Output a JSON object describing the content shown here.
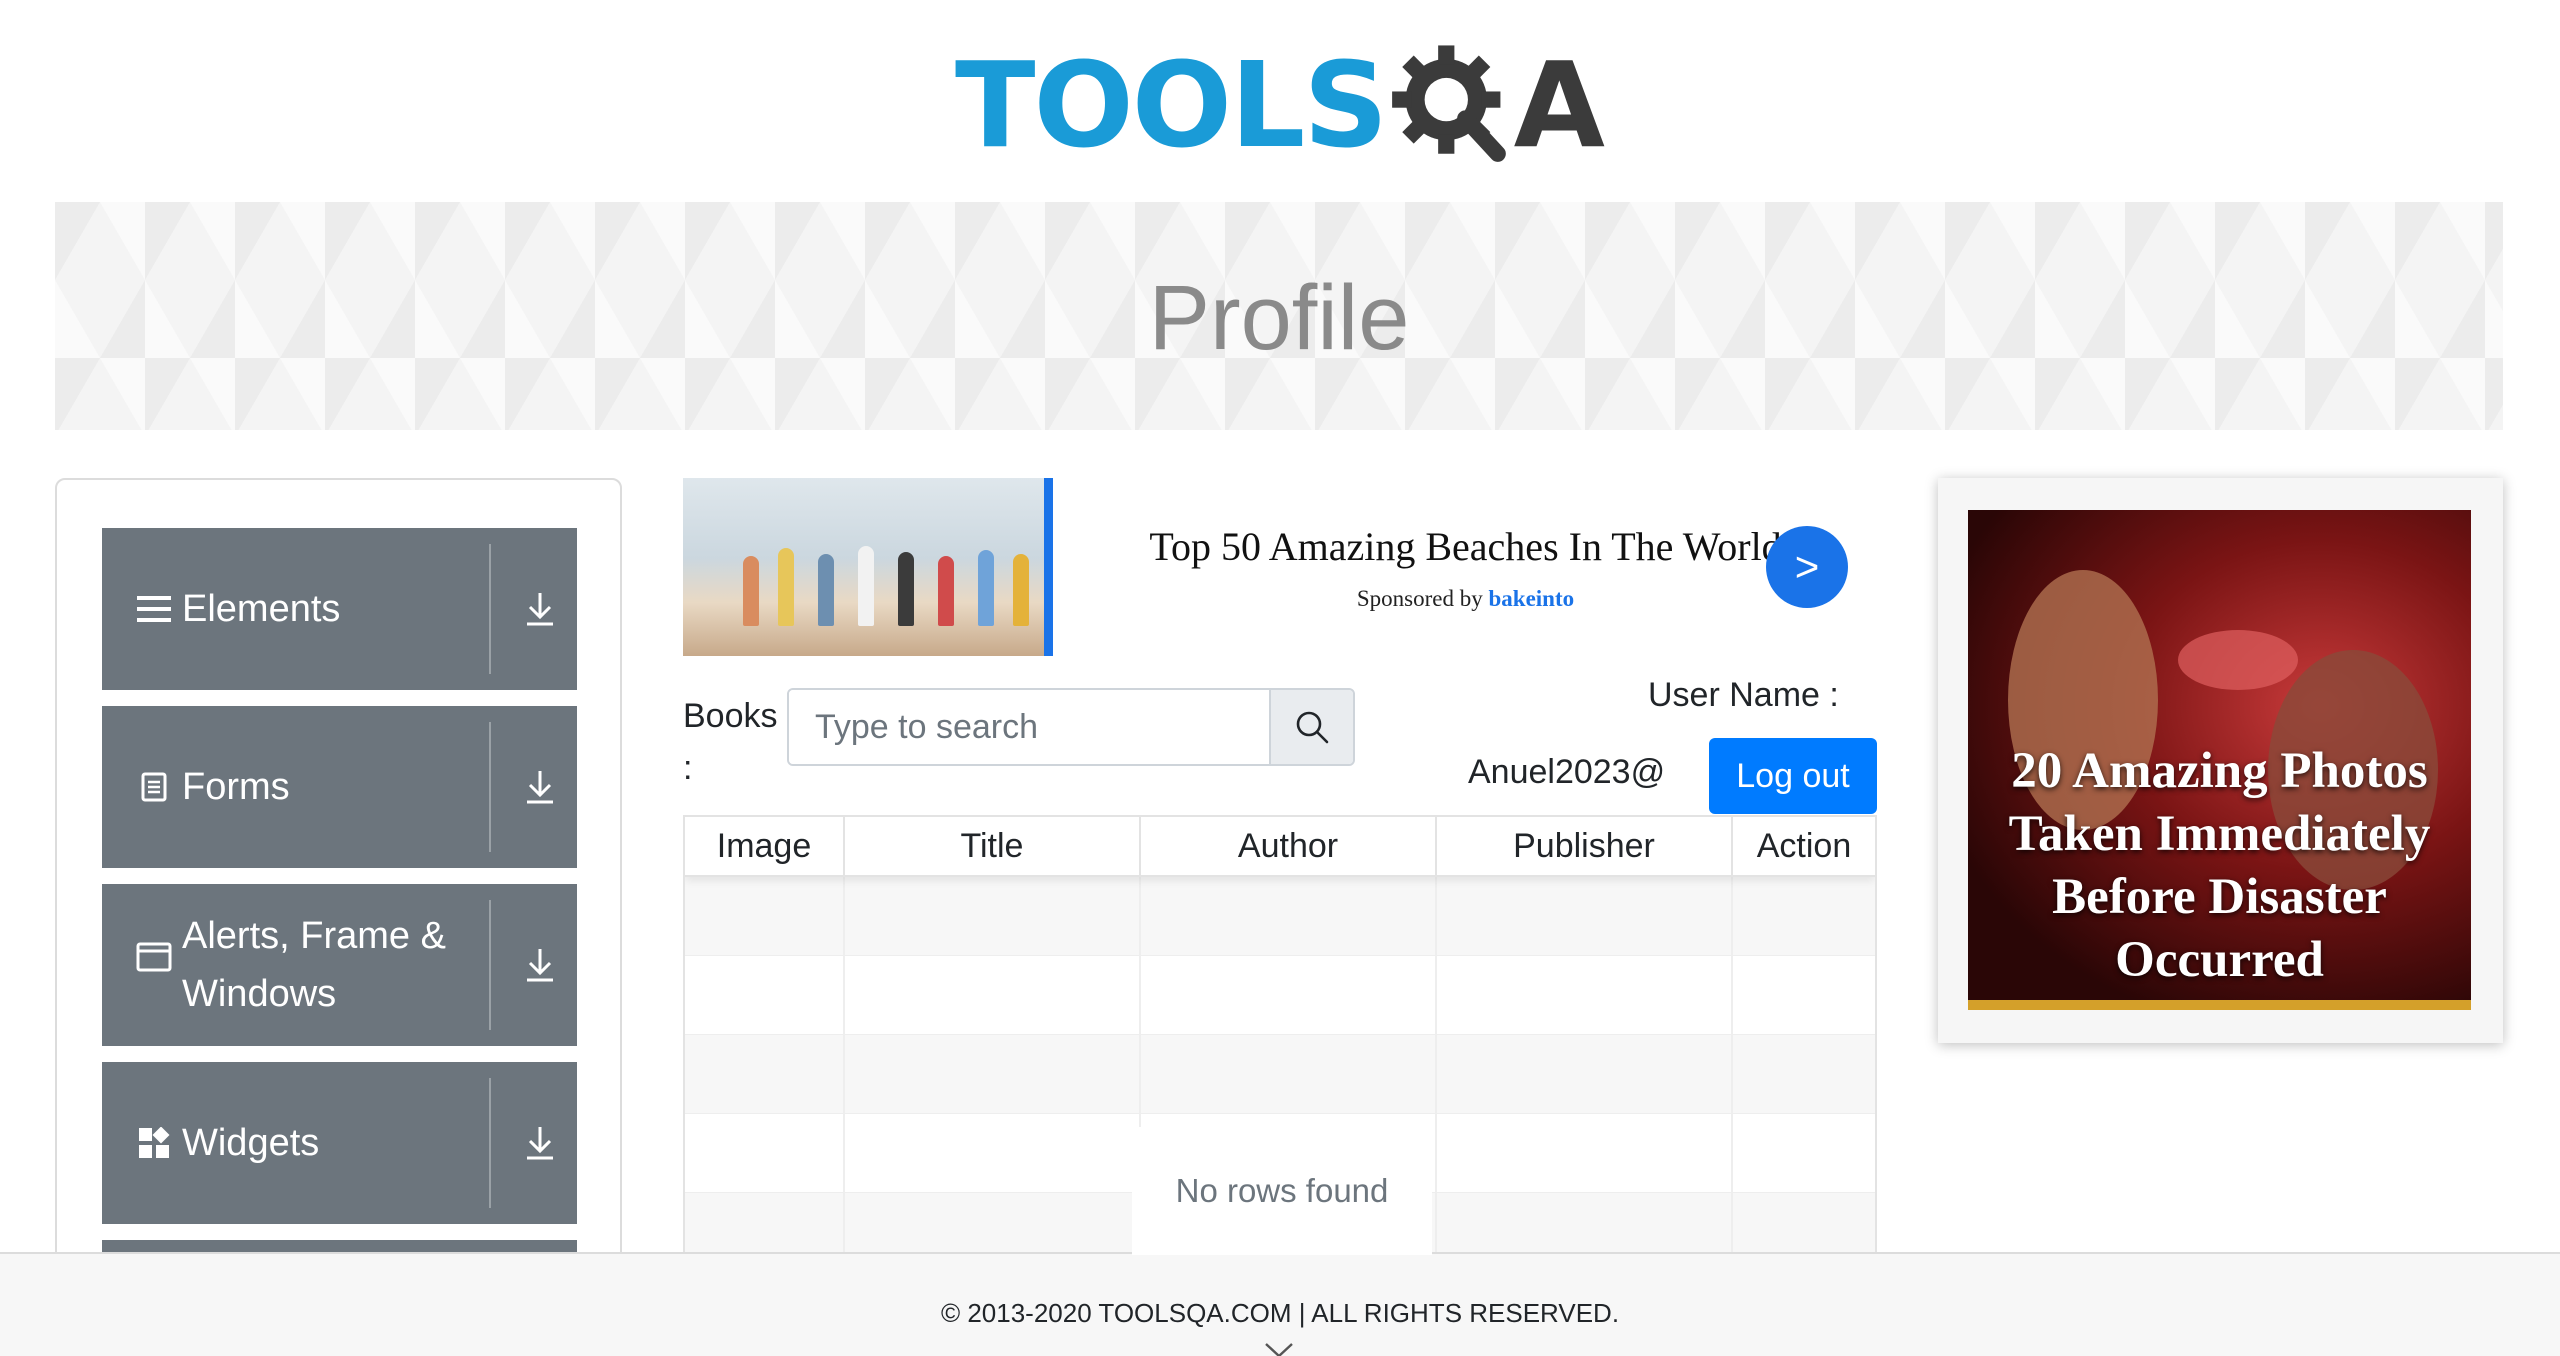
{
  "header": {
    "logo_tools": "TOOLS",
    "logo_a": "A",
    "colors": {
      "brand_blue": "#1a9bd7",
      "brand_dark": "#3b3b3b"
    }
  },
  "banner": {
    "title": "Profile"
  },
  "sidebar": {
    "groups": [
      {
        "label": "Elements",
        "icon": "hamburger-icon"
      },
      {
        "label": "Forms",
        "icon": "document-icon"
      },
      {
        "label": "Alerts, Frame & Windows",
        "icon": "window-icon"
      },
      {
        "label": "Widgets",
        "icon": "widgets-icon"
      }
    ],
    "group_color": "#6c757d"
  },
  "ad_center": {
    "title": "Top 50 Amazing Beaches In The World",
    "sponsored_prefix": "Sponsored by",
    "sponsor": "bakeinto",
    "go_label": ">"
  },
  "books": {
    "label": "Books :",
    "search_placeholder": "Type to search"
  },
  "user": {
    "label": "User Name :",
    "value": "Anuel2023@",
    "logout_label": "Log out"
  },
  "table": {
    "columns": [
      "Image",
      "Title",
      "Author",
      "Publisher",
      "Action"
    ],
    "empty_message": "No rows found"
  },
  "ad_right": {
    "headline": "20 Amazing Photos Taken Immediately Before Disaster Occurred"
  },
  "footer": {
    "copyright": "© 2013-2020 TOOLSQA.COM | ALL RIGHTS RESERVED."
  },
  "colors": {
    "primary": "#007bff",
    "ad_blue": "#1a73e8"
  }
}
